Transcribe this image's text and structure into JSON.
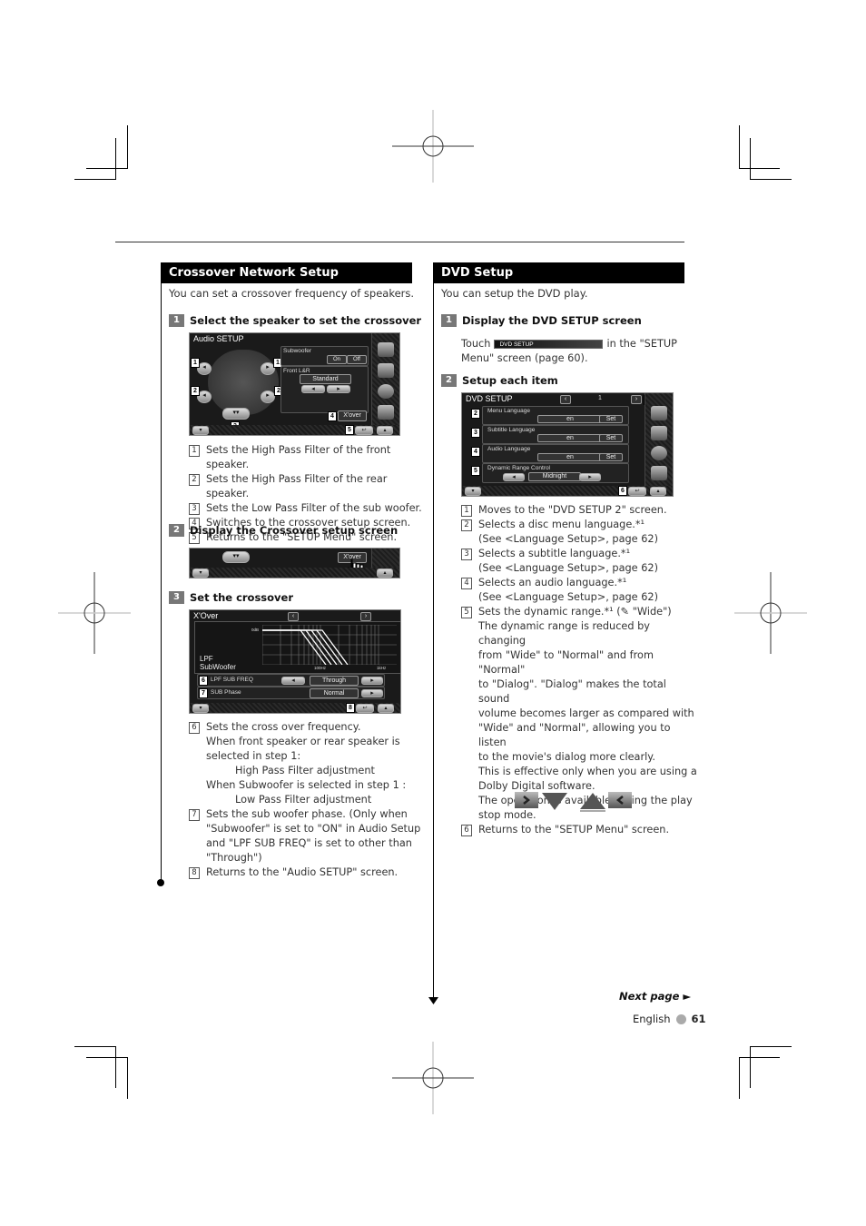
{
  "left": {
    "section_title": "Crossover Network Setup",
    "intro": "You can set a crossover frequency of speakers.",
    "steps": [
      {
        "num": "1",
        "title": "Select the speaker to set the crossover"
      },
      {
        "num": "2",
        "title": "Display the Crossover setup screen"
      },
      {
        "num": "3",
        "title": "Set the crossover"
      }
    ],
    "audio_setup_screen": {
      "title": "Audio SETUP",
      "subwoofer_label": "Subwoofer",
      "on_label": "On",
      "off_label": "Off",
      "front_label": "Front L&R",
      "front_value": "Standard",
      "xover_button": "X'over",
      "callouts": [
        "1",
        "1",
        "2",
        "2",
        "3",
        "4",
        "5"
      ]
    },
    "step1_items": [
      {
        "n": "1",
        "text": "Sets the High Pass Filter of the front speaker."
      },
      {
        "n": "2",
        "text": "Sets the High Pass Filter of the rear speaker."
      },
      {
        "n": "3",
        "text": "Sets the Low Pass Filter of the sub woofer."
      },
      {
        "n": "4",
        "text": "Switches to the crossover setup screen."
      },
      {
        "n": "5",
        "text": "Returns to the \"SETUP Menu\" screen."
      }
    ],
    "step2_screen": {
      "xover_button": "X'over"
    },
    "xover_screen": {
      "title": "X'Over",
      "graph_label_line1": "LPF",
      "graph_label_line2": "SubWoofer",
      "y_tick": "0dB",
      "x_tick_mid": "100Hz",
      "x_tick_right": "1kHz",
      "row1_label": "LPF SUB FREQ",
      "row1_value": "Through",
      "row2_label": "SUB Phase",
      "row2_value": "Normal",
      "callouts": [
        "6",
        "7",
        "8"
      ]
    },
    "step3_items": [
      {
        "n": "6",
        "lines": [
          "Sets the cross over frequency.",
          "When front speaker or rear speaker is",
          "selected in step 1:",
          "High Pass Filter adjustment",
          "When Subwoofer is selected in step 1 :",
          "Low Pass Filter adjustment"
        ]
      },
      {
        "n": "7",
        "lines": [
          "Sets the sub woofer phase. (Only when",
          "\"Subwoofer\" is set to \"ON\" in Audio Setup",
          "and \"LPF SUB FREQ\" is set to other than",
          "\"Through\")"
        ]
      },
      {
        "n": "8",
        "lines": [
          "Returns to the \"Audio SETUP\" screen."
        ]
      }
    ]
  },
  "right": {
    "section_title": "DVD Setup",
    "intro": "You can setup the DVD play.",
    "steps": [
      {
        "num": "1",
        "title": "Display the DVD SETUP screen"
      },
      {
        "num": "2",
        "title": "Setup each item"
      }
    ],
    "touch_text_before": "Touch",
    "touch_button": "DVD SETUP",
    "touch_text_after": "in the \"SETUP",
    "touch_text_line2": "Menu\" screen (page 60).",
    "dvd_screen": {
      "title": "DVD SETUP",
      "page": "1",
      "rows": [
        {
          "label": "Menu Language",
          "value": "en",
          "button": "Set"
        },
        {
          "label": "Subtitle Language",
          "value": "en",
          "button": "Set"
        },
        {
          "label": "Audio Language",
          "value": "en",
          "button": "Set"
        },
        {
          "label": "Dynamic Range Control",
          "value": "Midnight"
        }
      ],
      "callouts": [
        "1",
        "2",
        "3",
        "4",
        "5",
        "6"
      ]
    },
    "items": [
      {
        "n": "1",
        "lines": [
          "Moves to the \"DVD SETUP 2\" screen."
        ]
      },
      {
        "n": "2",
        "lines": [
          "Selects a disc menu language.*¹",
          "(See <Language Setup>, page 62)"
        ]
      },
      {
        "n": "3",
        "lines": [
          "Selects a subtitle language.*¹",
          "(See <Language Setup>, page 62)"
        ]
      },
      {
        "n": "4",
        "lines": [
          "Selects an audio language.*¹",
          "(See <Language Setup>, page 62)"
        ]
      },
      {
        "n": "5",
        "lines": [
          "Sets the dynamic range.*¹ (✎ \"Wide\")",
          "The dynamic range is reduced by changing",
          "from \"Wide\" to \"Normal\" and from \"Normal\"",
          "to \"Dialog\". \"Dialog\" makes the total sound",
          "volume becomes larger as compared with",
          "\"Wide\" and \"Normal\", allowing you to listen",
          "to the movie's dialog more clearly.",
          "This is effective only when you are using a",
          "Dolby Digital software.",
          "The operation is available during the play",
          "stop mode."
        ]
      },
      {
        "n": "6",
        "lines": [
          "Returns to the \"SETUP Menu\" screen."
        ]
      }
    ],
    "nav_icons": [
      "next-arrow-icon",
      "down-triangle-icon",
      "up-triangle-icon",
      "back-arrow-icon"
    ]
  },
  "footer": {
    "next_page": "Next page ►",
    "language": "English",
    "page_number": "61"
  }
}
